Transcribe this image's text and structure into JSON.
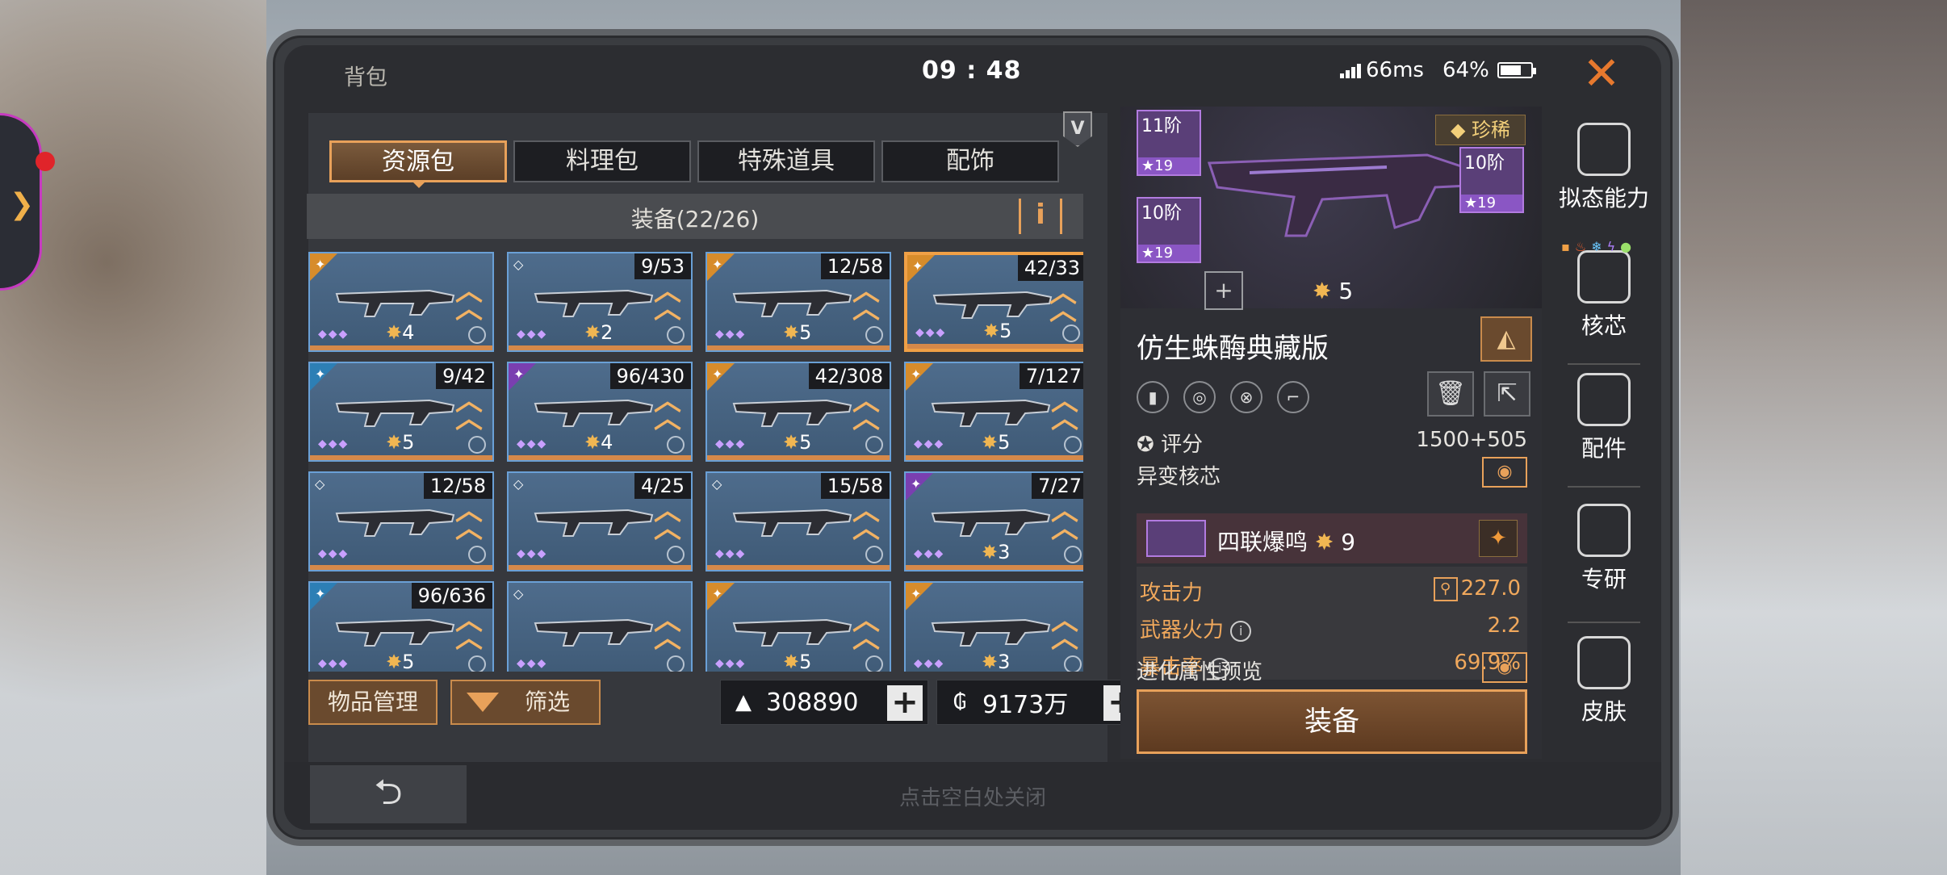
{
  "status": {
    "title": "背包",
    "clock": "09 : 48",
    "ping": "66ms",
    "battery": "64%",
    "close_icon": "close-icon"
  },
  "tabs": [
    {
      "label": "资源包",
      "active": true
    },
    {
      "label": "料理包",
      "active": false
    },
    {
      "label": "特殊道具",
      "active": false
    },
    {
      "label": "配饰",
      "active": false
    }
  ],
  "equip_header": {
    "label": "装备(22/26)",
    "info_icon": "i"
  },
  "grid": [
    {
      "count": "",
      "stars": "4",
      "rank": "gold",
      "selected": false,
      "locked": true
    },
    {
      "count": "9/53",
      "stars": "2",
      "rank": "none",
      "selected": false
    },
    {
      "count": "12/58",
      "stars": "5",
      "rank": "gold",
      "selected": false
    },
    {
      "count": "42/33",
      "stars": "5",
      "rank": "gold",
      "selected": true
    },
    {
      "count": "9/42",
      "stars": "5",
      "rank": "blue",
      "selected": false
    },
    {
      "count": "96/430",
      "stars": "4",
      "rank": "purple",
      "selected": false
    },
    {
      "count": "42/308",
      "stars": "5",
      "rank": "gold",
      "selected": false
    },
    {
      "count": "7/127",
      "stars": "5",
      "rank": "gold",
      "selected": false
    },
    {
      "count": "12/58",
      "stars": "",
      "rank": "none",
      "selected": false
    },
    {
      "count": "4/25",
      "stars": "",
      "rank": "none",
      "selected": false
    },
    {
      "count": "15/58",
      "stars": "",
      "rank": "none",
      "selected": false
    },
    {
      "count": "7/27",
      "stars": "3",
      "rank": "purple",
      "selected": false
    },
    {
      "count": "96/636",
      "stars": "5",
      "rank": "blue",
      "selected": false
    },
    {
      "count": "",
      "stars": "",
      "rank": "none",
      "selected": false
    },
    {
      "count": "",
      "stars": "5",
      "rank": "gold",
      "selected": false
    },
    {
      "count": "",
      "stars": "3",
      "rank": "gold",
      "selected": false
    }
  ],
  "bottom_left": {
    "manage_label": "物品管理",
    "filter_label": "筛选"
  },
  "currency": [
    {
      "icon": "ingot-icon",
      "value": "308890"
    },
    {
      "icon": "coin-icon",
      "value": "9173万"
    }
  ],
  "close_hint": "点击空白处关闭",
  "detail": {
    "parts": [
      {
        "label": "11阶",
        "value": "19"
      },
      {
        "label": "10阶",
        "value": "19"
      },
      {
        "label": "10阶",
        "value": "19"
      }
    ],
    "rarity": "珍稀",
    "gun_stars": "5",
    "name": "仿生蛛酶典藏版",
    "score_label": "评分",
    "score_value": "1500+505",
    "mutation_label": "异变核芯",
    "core_name": "四联爆鸣",
    "core_stars": "9",
    "stats": [
      {
        "label": "攻击力",
        "value": "227.0"
      },
      {
        "label": "武器火力",
        "value": "2.2"
      },
      {
        "label": "暴击率",
        "value": "69.9%"
      }
    ],
    "evolution_label": "进化属性预览",
    "equip_label": "装备"
  },
  "side_menu": [
    {
      "label": "拟态能力",
      "icon": "mimic-ability-icon"
    },
    {
      "label": "核芯",
      "icon": "core-icon"
    },
    {
      "label": "配件",
      "icon": "attachment-icon"
    },
    {
      "label": "专研",
      "icon": "research-icon"
    },
    {
      "label": "皮肤",
      "icon": "skin-icon"
    }
  ],
  "colors": {
    "accent": "#e8a15a",
    "cell_blue": "#4e6c8c",
    "purple": "#8a56c4"
  }
}
